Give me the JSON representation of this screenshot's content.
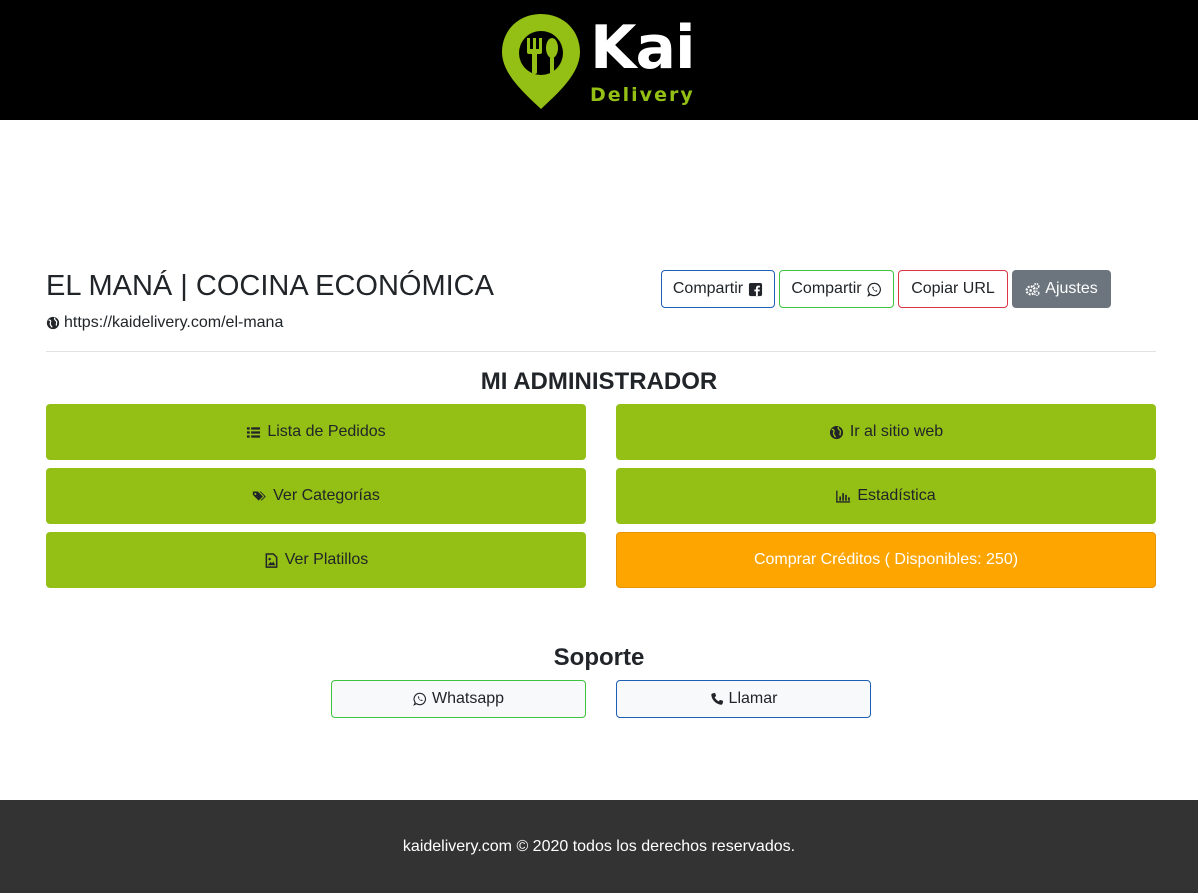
{
  "header": {
    "logo_text": "Kai",
    "logo_subtext": "Delivery",
    "bg_color": "#000000",
    "brand_color": "#94bf14"
  },
  "store": {
    "name": "EL MANÁ | COCINA ECONÓMICA",
    "url": "https://kaidelivery.com/el-mana",
    "url_icon": "globe-icon"
  },
  "actions": {
    "share_facebook": "Compartir",
    "share_facebook_icon": "facebook-square-icon",
    "share_whatsapp": "Compartir",
    "share_whatsapp_icon": "whatsapp-icon",
    "copy_url": "Copiar URL",
    "settings": "Ajustes",
    "settings_icon": "gears-icon"
  },
  "admin": {
    "title": "MI ADMINISTRADOR",
    "tiles": [
      {
        "label": "Lista de Pedidos",
        "icon": "list-icon",
        "color": "#94bf14"
      },
      {
        "label": "Ir al sitio web",
        "icon": "globe-icon",
        "color": "#94bf14"
      },
      {
        "label": "Ver Categorías",
        "icon": "tags-icon",
        "color": "#94bf14"
      },
      {
        "label": "Estadística",
        "icon": "bar-chart-icon",
        "color": "#94bf14"
      },
      {
        "label": "Ver Platillos",
        "icon": "image-file-icon",
        "color": "#94bf14"
      },
      {
        "label": "Comprar Créditos ( Disponibles: 250)",
        "icon": "",
        "color": "#ffa500"
      }
    ]
  },
  "support": {
    "title": "Soporte",
    "whatsapp_label": "Whatsapp",
    "whatsapp_icon": "whatsapp-icon",
    "call_label": "Llamar",
    "call_icon": "phone-icon"
  },
  "footer": {
    "text": "kaidelivery.com © 2020 todos los derechos reservados."
  }
}
